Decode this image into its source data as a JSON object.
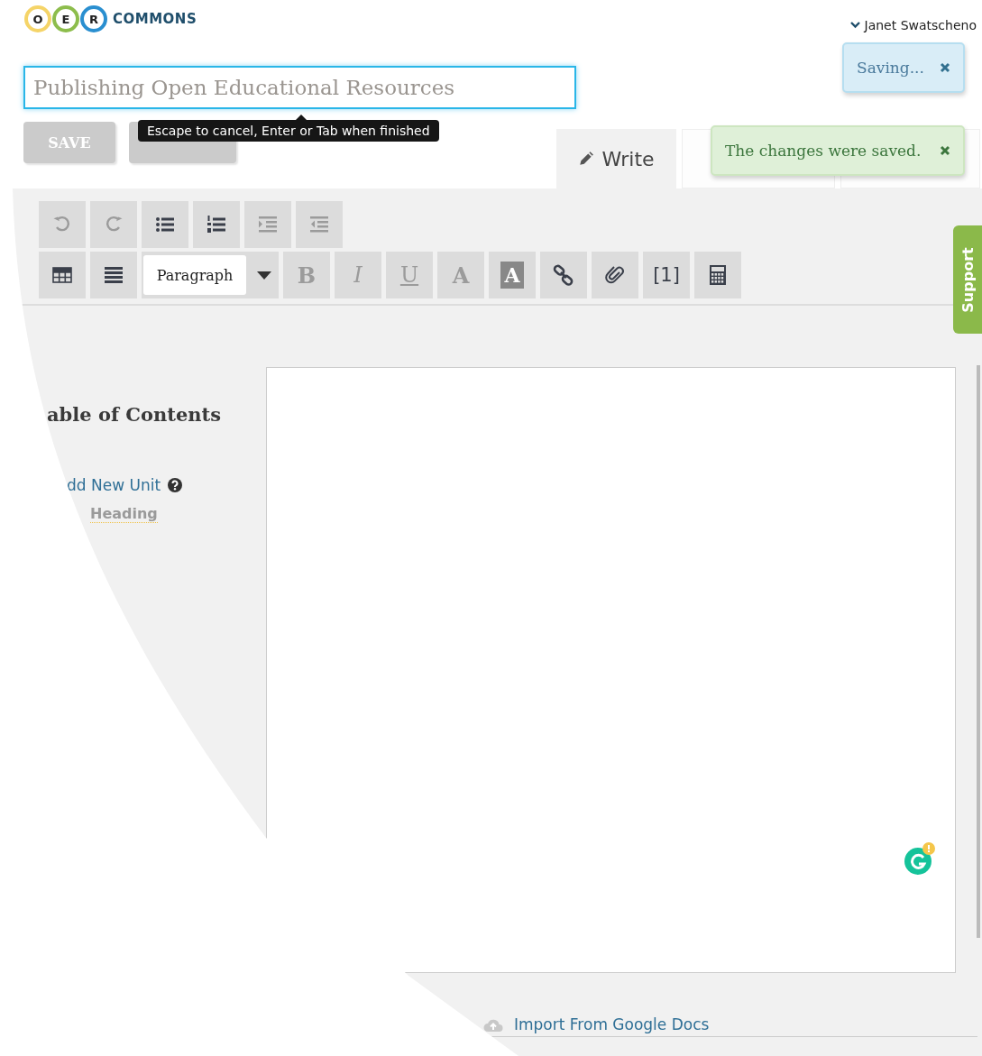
{
  "logo": {
    "letters": [
      {
        "text": "O",
        "color": "#f5d468"
      },
      {
        "text": "E",
        "color": "#8dbd4c"
      },
      {
        "text": "R",
        "color": "#2a8fd0"
      }
    ],
    "text": "COMMONS"
  },
  "user": {
    "name": "Janet Swatscheno"
  },
  "title_field": {
    "value": "Publishing Open Educational Resources",
    "focused": true
  },
  "tooltip": "Escape to cancel, Enter or Tab when finished",
  "buttons": [
    {
      "label": "SAVE",
      "disabled": true
    },
    {
      "disabled": true
    }
  ],
  "tabs": [
    {
      "label": "Write",
      "selected": true
    },
    {
      "selected": false
    },
    {
      "selected": false
    }
  ],
  "toasts": [
    {
      "kind": "info",
      "text": "Saving..."
    },
    {
      "kind": "success",
      "text": "The changes were saved."
    }
  ],
  "toolbar": {
    "rows": [
      [
        {
          "kind": "undo",
          "disabled": true
        },
        {
          "kind": "redo",
          "disabled": true
        },
        {
          "kind": "bullet-list",
          "disabled": false
        },
        {
          "kind": "numbered-list",
          "disabled": false
        },
        {
          "kind": "indent",
          "disabled": true
        },
        {
          "kind": "outdent",
          "disabled": true
        }
      ],
      [
        {
          "kind": "table",
          "disabled": false
        },
        {
          "kind": "align",
          "disabled": false
        },
        {
          "kind": "format-select",
          "value": "Paragraph",
          "disabled": false
        },
        {
          "kind": "bold",
          "label": "B",
          "disabled": true
        },
        {
          "kind": "italic",
          "label": "I",
          "disabled": true
        },
        {
          "kind": "underline",
          "label": "U",
          "disabled": true
        },
        {
          "kind": "font-color",
          "label": "A",
          "disabled": true
        },
        {
          "kind": "letter-highlight",
          "label": "A",
          "disabled": false
        },
        {
          "kind": "link",
          "disabled": false
        },
        {
          "kind": "attachment",
          "disabled": false
        },
        {
          "kind": "text-button",
          "label": "[1]",
          "disabled": false
        },
        {
          "kind": "calculator",
          "disabled": false
        }
      ]
    ]
  },
  "toc": {
    "title": "able of Contents",
    "add_unit": "dd New Unit",
    "heading": "Heading"
  },
  "support_tab": "Support",
  "import_link": "Import From Google Docs"
}
